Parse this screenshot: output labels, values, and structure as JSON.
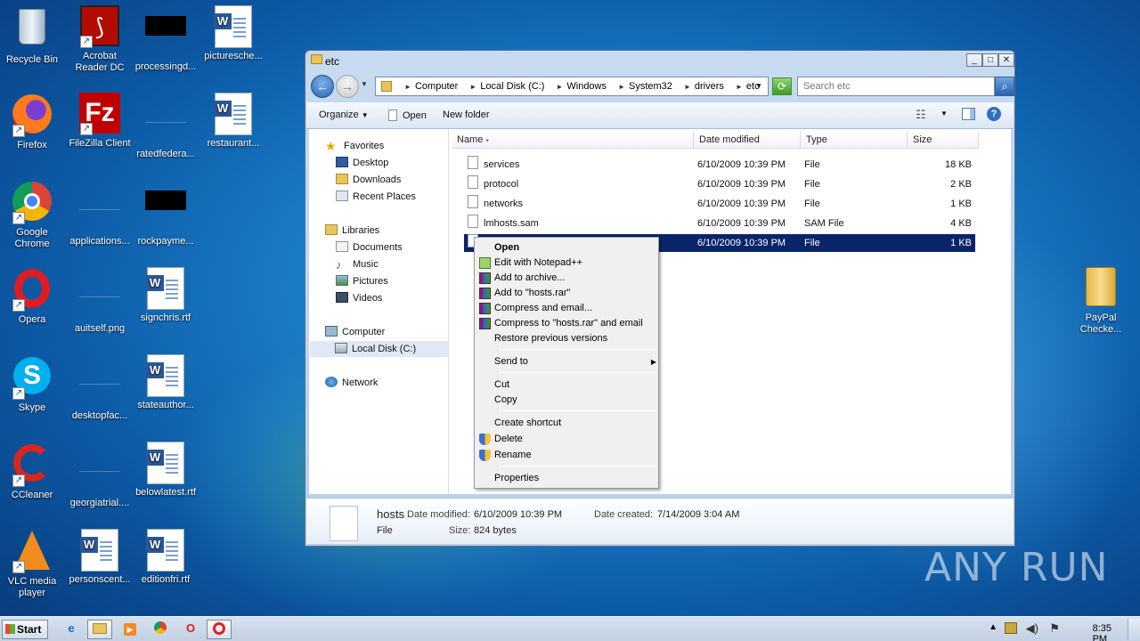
{
  "desktop": {
    "icons": [
      {
        "label": "Recycle Bin"
      },
      {
        "label": "Acrobat Reader DC"
      },
      {
        "label": "processingd..."
      },
      {
        "label": "picturesche..."
      },
      {
        "label": "Firefox"
      },
      {
        "label": "FileZilla Client"
      },
      {
        "label": "ratedfedera..."
      },
      {
        "label": "restaurant..."
      },
      {
        "label": "Google Chrome"
      },
      {
        "label": "applications..."
      },
      {
        "label": "rockpayme..."
      },
      {
        "label": "Opera"
      },
      {
        "label": "auitself.png"
      },
      {
        "label": "signchris.rtf"
      },
      {
        "label": "Skype"
      },
      {
        "label": "desktopfac..."
      },
      {
        "label": "stateauthor..."
      },
      {
        "label": "CCleaner"
      },
      {
        "label": "georgiatrial...."
      },
      {
        "label": "belowlatest.rtf"
      },
      {
        "label": "VLC media player"
      },
      {
        "label": "personscent..."
      },
      {
        "label": "editionfri.rtf"
      },
      {
        "label": "PayPal Checke..."
      }
    ]
  },
  "window": {
    "title": "etc",
    "buttons": {
      "minimize": "_",
      "maximize": "□",
      "close": "✕"
    },
    "breadcrumb": [
      "Computer",
      "Local Disk (C:)",
      "Windows",
      "System32",
      "drivers",
      "etc"
    ],
    "search_placeholder": "Search etc",
    "toolbar": {
      "organize": "Organize",
      "open": "Open",
      "new_folder": "New folder"
    },
    "nav": {
      "favorites": "Favorites",
      "desktop": "Desktop",
      "downloads": "Downloads",
      "recent": "Recent Places",
      "libraries": "Libraries",
      "documents": "Documents",
      "music": "Music",
      "pictures": "Pictures",
      "videos": "Videos",
      "computer": "Computer",
      "local_disk": "Local Disk (C:)",
      "network": "Network"
    },
    "columns": {
      "name": "Name",
      "date": "Date modified",
      "type": "Type",
      "size": "Size"
    },
    "files": [
      {
        "name": "services",
        "date": "6/10/2009 10:39 PM",
        "type": "File",
        "size": "18 KB"
      },
      {
        "name": "protocol",
        "date": "6/10/2009 10:39 PM",
        "type": "File",
        "size": "2 KB"
      },
      {
        "name": "networks",
        "date": "6/10/2009 10:39 PM",
        "type": "File",
        "size": "1 KB"
      },
      {
        "name": "lmhosts.sam",
        "date": "6/10/2009 10:39 PM",
        "type": "SAM File",
        "size": "4 KB"
      },
      {
        "name": "",
        "date": "6/10/2009 10:39 PM",
        "type": "File",
        "size": "1 KB"
      }
    ],
    "details": {
      "name": "hosts",
      "modified_label": "Date modified:",
      "modified": "6/10/2009 10:39 PM",
      "created_label": "Date created:",
      "created": "7/14/2009 3:04 AM",
      "type": "File",
      "size_label": "Size:",
      "size": "824 bytes"
    }
  },
  "context_menu": {
    "open": "Open",
    "edit_npp": "Edit with Notepad++",
    "add_archive": "Add to archive...",
    "add_rar": "Add to \"hosts.rar\"",
    "compress_email": "Compress and email...",
    "compress_rar_email": "Compress to \"hosts.rar\" and email",
    "restore": "Restore previous versions",
    "send_to": "Send to",
    "cut": "Cut",
    "copy": "Copy",
    "create_shortcut": "Create shortcut",
    "delete": "Delete",
    "rename": "Rename",
    "properties": "Properties"
  },
  "taskbar": {
    "start": "Start",
    "clock": "8:35 PM"
  },
  "watermark": "ANY RUN"
}
